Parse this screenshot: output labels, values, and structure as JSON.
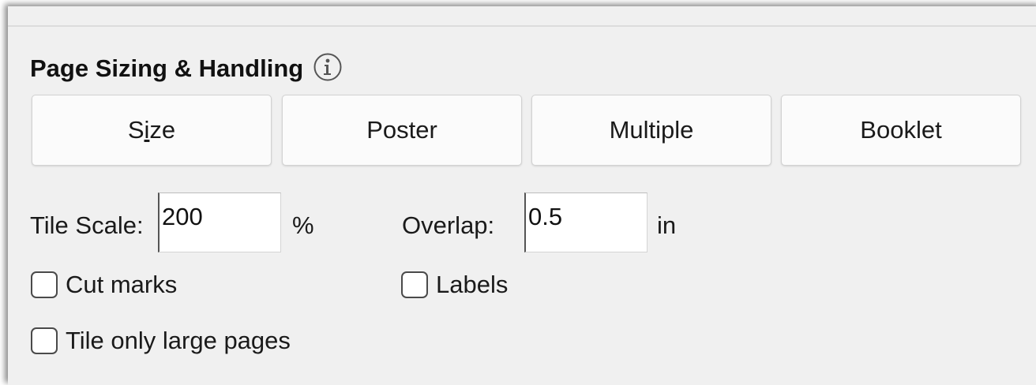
{
  "section": {
    "title": "Page Sizing & Handling",
    "info_icon": "info-circle-icon"
  },
  "tabs": [
    {
      "label_pre": "S",
      "label_ul": "i",
      "label_post": "ze"
    },
    {
      "label": "Poster"
    },
    {
      "label": "Multiple"
    },
    {
      "label": "Booklet"
    }
  ],
  "tile_scale": {
    "label": "Tile Scale:",
    "value": "200",
    "unit": "%"
  },
  "overlap": {
    "label": "Overlap:",
    "value": "0.5",
    "unit": "in"
  },
  "checkboxes": {
    "cut_marks": {
      "label": "Cut marks",
      "checked": false
    },
    "labels": {
      "label": "Labels",
      "checked": false
    },
    "tile_only_large": {
      "label": "Tile only large pages",
      "checked": false
    }
  }
}
